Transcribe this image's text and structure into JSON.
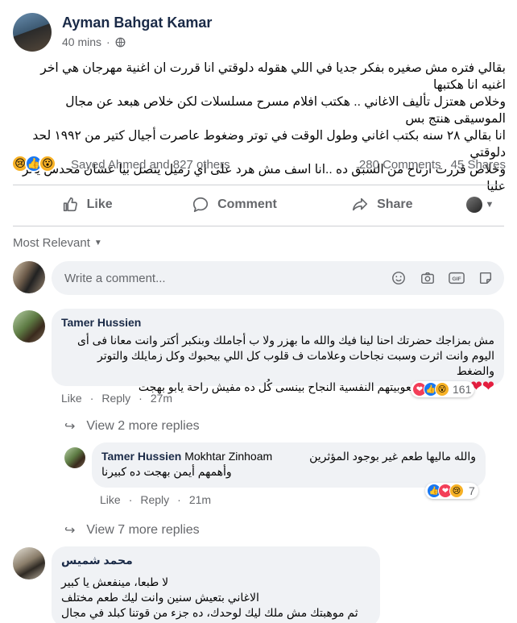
{
  "post": {
    "author": "Ayman Bahgat Kamar",
    "time": "40 mins",
    "privacy_icon": "globe-icon",
    "text_lines": [
      "بقالي فتره مش صغيره بفكر جديا في اللي هقوله دلوقتي انا قررت ان اغنية مهرجان هي اخر اغنيه انا هكتبها",
      "وخلاص هعتزل تأليف الاغاني .. هكتب افلام مسرح مسلسلات لكن خلاص هبعد عن مجال الموسيقى هنتج بس",
      "انا بقالي ٢٨ سنه بكتب اغاني وطول الوقت في توتر وضغوط عاصرت أجيال كتير من ١٩٩٢ لحد دلوقتي",
      "وخلاص قررت ارتاح من السبق ده ..انا اسف مش هرد على اي زميل يتصل بيا عشان محدش يأثر عليا"
    ],
    "reactions": [
      "sad",
      "like",
      "wow"
    ],
    "reaction_names": "Sayed Ahmed and 827 others",
    "comments_count": "280 Comments",
    "shares_count": "45 Shares"
  },
  "actions": {
    "like": "Like",
    "comment": "Comment",
    "share": "Share"
  },
  "filter": {
    "label": "Most Relevant"
  },
  "composer": {
    "placeholder": "Write a comment...",
    "icons": [
      "emoji-icon",
      "camera-icon",
      "gif-icon",
      "sticker-icon"
    ]
  },
  "comments": [
    {
      "author": "Tamer Hussien",
      "lines": [
        "مش بمزاجك حضرتك احنا لينا فيك والله ما بهزر ولا ب أجاملك وبنكبر أكتر وانت معانا فى أى",
        "اليوم وانت اثرت وسبت نجاحات وعلامات ف قلوب كل اللي بيحبوك وكل زمايلك والتوتر والضغط",
        "رغم صعوبيتهم النفسية النجاح بينسى كُل ده مفيش راحة يابو بهجت"
      ],
      "hearts": "❤❤❤❤",
      "like": "Like",
      "reply": "Reply",
      "time": "27m",
      "reaction_count": "161",
      "more_replies": "View 2 more replies"
    },
    {
      "author": "Tamer Hussien",
      "mention": "Mokhtar Zinhoam",
      "lines": [
        "والله ماليها طعم غير بوجود المؤثرين",
        "وأهمهم أيمن بهجت ده كبيرنا"
      ],
      "like": "Like",
      "reply": "Reply",
      "time": "21m",
      "reaction_count": "7",
      "more_replies": "View 7 more replies"
    },
    {
      "author": "محمد شميس",
      "lines": [
        "لا طبعا، مينفعش يا كبير",
        "الاغاني بتعيش سنين وانت ليك طعم مختلف",
        "ثم موهبتك مش ملك ليك لوحدك، ده جزء من قوتنا كبلد في مجال الموسيقى"
      ]
    }
  ]
}
